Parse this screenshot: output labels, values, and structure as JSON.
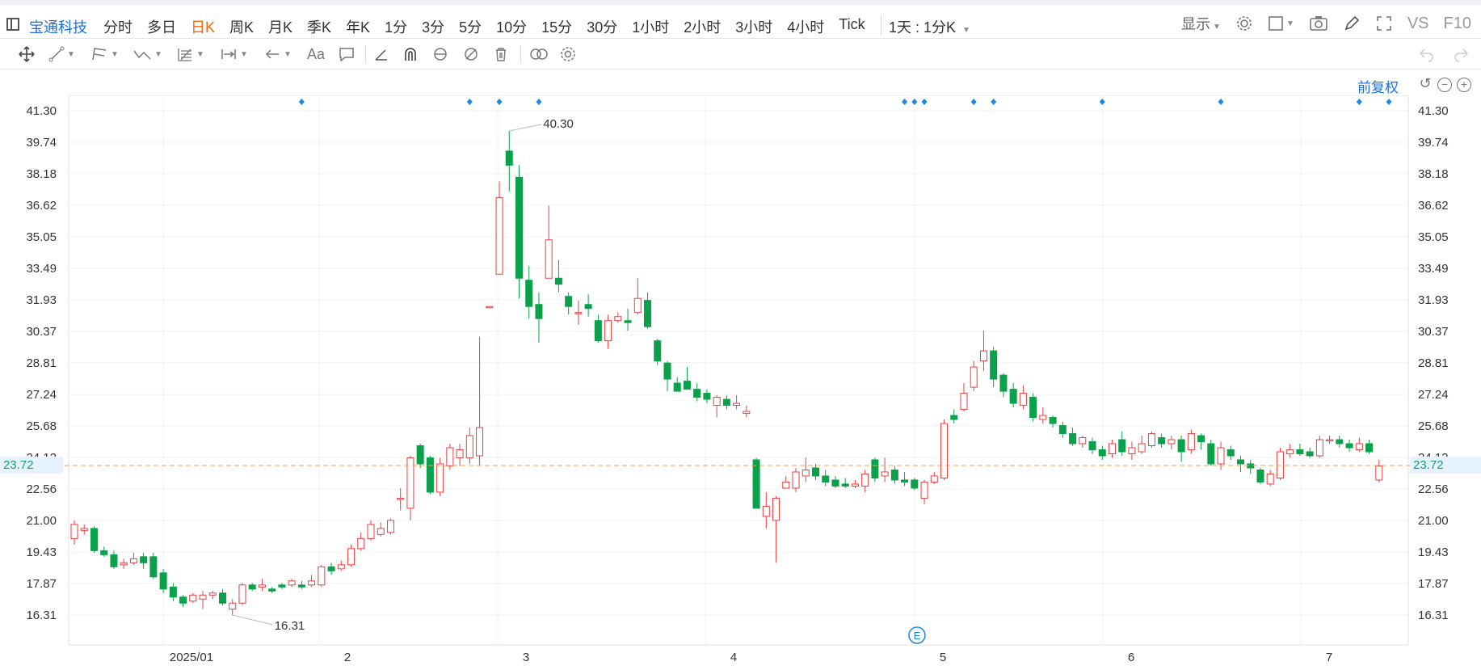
{
  "header": {
    "stock_name": "宝通科技",
    "periods": [
      "分时",
      "多日",
      "日K",
      "周K",
      "月K",
      "季K",
      "年K",
      "1分",
      "3分",
      "5分",
      "10分",
      "15分",
      "30分",
      "1小时",
      "2小时",
      "3小时",
      "4小时",
      "Tick"
    ],
    "active_period": "日K",
    "k_combo": "1天 : 1分K",
    "display_label": "显示",
    "vs_label": "VS",
    "f10_label": "F10"
  },
  "adjust": {
    "label": "前复权"
  },
  "chart_data": {
    "type": "candlestick",
    "y_ticks": [
      "41.30",
      "39.74",
      "38.18",
      "36.62",
      "35.05",
      "33.49",
      "31.93",
      "30.37",
      "28.81",
      "27.24",
      "25.68",
      "24.12",
      "22.56",
      "21.00",
      "19.43",
      "17.87",
      "16.31"
    ],
    "y_range": [
      16.31,
      41.3
    ],
    "x_labels": [
      "2025/01",
      "2",
      "3",
      "4",
      "5",
      "6",
      "7"
    ],
    "last_price": "23.72",
    "max_label": "40.30",
    "min_label": "16.31",
    "event_badge": "E",
    "up_color": "#e84141",
    "down_color": "#0aa14a",
    "grid": true,
    "candles": [
      [
        20.1,
        20.8,
        21.0,
        19.8
      ],
      [
        20.5,
        20.6,
        20.8,
        20.3
      ],
      [
        20.6,
        19.5,
        20.7,
        19.4
      ],
      [
        19.5,
        19.3,
        19.7,
        19.2
      ],
      [
        19.3,
        18.7,
        19.5,
        18.6
      ],
      [
        18.8,
        18.9,
        19.1,
        18.6
      ],
      [
        18.9,
        19.1,
        19.4,
        18.8
      ],
      [
        19.2,
        18.9,
        19.4,
        18.6
      ],
      [
        19.2,
        18.2,
        19.4,
        18.1
      ],
      [
        18.4,
        17.6,
        18.6,
        17.4
      ],
      [
        17.7,
        17.2,
        17.9,
        17.0
      ],
      [
        17.2,
        16.9,
        17.3,
        16.7
      ],
      [
        17.0,
        17.3,
        17.4,
        16.9
      ],
      [
        17.1,
        17.3,
        17.5,
        16.6
      ],
      [
        17.3,
        17.4,
        17.5,
        17.1
      ],
      [
        17.4,
        16.9,
        17.6,
        16.8
      ],
      [
        16.6,
        16.9,
        17.1,
        16.3
      ],
      [
        16.9,
        17.8,
        17.9,
        16.8
      ],
      [
        17.8,
        17.6,
        17.9,
        17.5
      ],
      [
        17.7,
        17.8,
        18.1,
        17.5
      ],
      [
        17.6,
        17.5,
        17.7,
        17.4
      ],
      [
        17.8,
        17.7,
        17.9,
        17.6
      ],
      [
        17.8,
        18.0,
        18.1,
        17.7
      ],
      [
        17.8,
        17.7,
        18.0,
        17.6
      ],
      [
        17.8,
        18.0,
        18.3,
        17.7
      ],
      [
        17.8,
        18.7,
        18.8,
        17.7
      ],
      [
        18.7,
        18.5,
        18.9,
        18.3
      ],
      [
        18.6,
        18.8,
        19.0,
        18.5
      ],
      [
        18.8,
        19.6,
        19.8,
        18.7
      ],
      [
        19.6,
        20.1,
        20.4,
        19.5
      ],
      [
        20.1,
        20.8,
        21.0,
        20.0
      ],
      [
        20.3,
        20.6,
        20.9,
        20.2
      ],
      [
        20.4,
        21.0,
        21.1,
        20.3
      ],
      [
        22.1,
        22.1,
        22.6,
        21.5
      ],
      [
        21.6,
        24.1,
        24.2,
        21.0
      ],
      [
        24.7,
        23.8,
        24.8,
        23.6
      ],
      [
        24.1,
        22.4,
        24.2,
        22.3
      ],
      [
        22.4,
        23.8,
        24.1,
        22.2
      ],
      [
        23.7,
        24.6,
        24.8,
        23.5
      ],
      [
        24.1,
        24.5,
        24.8,
        23.7
      ],
      [
        24.1,
        25.2,
        25.6,
        23.8
      ],
      [
        24.2,
        25.6,
        30.1,
        23.7
      ],
      [
        31.6,
        31.6,
        31.6,
        31.6
      ],
      [
        33.2,
        37.0,
        37.8,
        33.2
      ],
      [
        39.3,
        38.6,
        40.3,
        37.3
      ],
      [
        38.0,
        33.0,
        38.6,
        32.0
      ],
      [
        32.9,
        31.6,
        33.6,
        31.0
      ],
      [
        31.7,
        31.0,
        32.3,
        29.8
      ],
      [
        33.0,
        34.9,
        36.6,
        33.0
      ],
      [
        33.0,
        32.7,
        33.9,
        32.3
      ],
      [
        32.1,
        31.6,
        32.3,
        31.2
      ],
      [
        31.3,
        31.3,
        31.9,
        30.7
      ],
      [
        31.7,
        31.5,
        32.2,
        31.1
      ],
      [
        30.9,
        29.9,
        31.2,
        29.8
      ],
      [
        29.9,
        30.9,
        31.2,
        29.5
      ],
      [
        30.9,
        31.1,
        31.3,
        30.8
      ],
      [
        30.9,
        30.8,
        31.5,
        30.4
      ],
      [
        31.3,
        32.0,
        33.0,
        31.2
      ],
      [
        31.9,
        30.6,
        32.3,
        30.5
      ],
      [
        29.9,
        28.9,
        30.0,
        28.7
      ],
      [
        28.8,
        28.0,
        28.9,
        27.4
      ],
      [
        27.8,
        27.4,
        28.1,
        27.4
      ],
      [
        27.9,
        27.5,
        28.6,
        27.5
      ],
      [
        27.5,
        27.1,
        27.8,
        26.9
      ],
      [
        27.3,
        27.0,
        27.5,
        26.8
      ],
      [
        26.7,
        27.1,
        27.2,
        26.1
      ],
      [
        27.0,
        26.7,
        27.2,
        26.5
      ],
      [
        26.7,
        26.8,
        27.2,
        26.5
      ],
      [
        26.3,
        26.4,
        26.7,
        26.1
      ],
      [
        24.0,
        21.6,
        24.1,
        21.6
      ],
      [
        21.2,
        21.7,
        22.4,
        20.6
      ],
      [
        21.0,
        22.1,
        22.2,
        18.9
      ],
      [
        22.6,
        22.9,
        23.2,
        22.6
      ],
      [
        22.6,
        23.4,
        23.6,
        22.4
      ],
      [
        23.2,
        23.5,
        24.1,
        22.9
      ],
      [
        23.6,
        23.2,
        23.8,
        23.0
      ],
      [
        23.2,
        22.9,
        23.5,
        22.7
      ],
      [
        23.0,
        22.7,
        23.2,
        22.6
      ],
      [
        22.8,
        22.7,
        23.1,
        22.6
      ],
      [
        22.7,
        22.8,
        23.0,
        22.6
      ],
      [
        22.7,
        23.3,
        23.5,
        22.4
      ],
      [
        24.0,
        23.1,
        24.1,
        22.9
      ],
      [
        23.2,
        23.4,
        24.1,
        22.9
      ],
      [
        23.5,
        23.0,
        23.7,
        22.8
      ],
      [
        23.0,
        22.9,
        23.4,
        22.7
      ],
      [
        23.0,
        22.6,
        23.1,
        22.5
      ],
      [
        22.1,
        22.9,
        23.0,
        21.8
      ],
      [
        22.9,
        23.2,
        23.4,
        22.8
      ],
      [
        23.1,
        25.8,
        26.0,
        23.0
      ],
      [
        26.2,
        26.0,
        26.5,
        25.8
      ],
      [
        26.5,
        27.3,
        27.8,
        26.4
      ],
      [
        27.6,
        28.6,
        28.9,
        27.4
      ],
      [
        28.9,
        29.4,
        30.4,
        28.4
      ],
      [
        29.4,
        28.0,
        29.6,
        27.6
      ],
      [
        28.2,
        27.4,
        28.3,
        27.1
      ],
      [
        27.5,
        26.8,
        27.8,
        26.6
      ],
      [
        26.7,
        27.3,
        27.7,
        26.5
      ],
      [
        27.1,
        26.1,
        27.3,
        25.9
      ],
      [
        26.0,
        26.2,
        26.6,
        25.8
      ],
      [
        26.1,
        25.8,
        26.2,
        25.6
      ],
      [
        25.7,
        25.3,
        25.9,
        25.1
      ],
      [
        25.3,
        24.8,
        25.6,
        24.7
      ],
      [
        24.8,
        25.1,
        25.2,
        24.6
      ],
      [
        24.9,
        24.5,
        25.1,
        24.3
      ],
      [
        24.5,
        24.2,
        24.7,
        24.0
      ],
      [
        24.3,
        24.8,
        25.0,
        24.1
      ],
      [
        25.0,
        24.4,
        25.4,
        24.2
      ],
      [
        24.3,
        24.6,
        24.9,
        24.0
      ],
      [
        24.4,
        24.8,
        25.2,
        24.3
      ],
      [
        24.7,
        25.3,
        25.4,
        24.6
      ],
      [
        25.1,
        24.8,
        25.3,
        24.6
      ],
      [
        24.8,
        25.0,
        25.2,
        24.5
      ],
      [
        25.0,
        24.4,
        25.2,
        23.9
      ],
      [
        24.5,
        25.3,
        25.5,
        24.3
      ],
      [
        25.2,
        24.9,
        25.3,
        24.5
      ],
      [
        24.8,
        23.8,
        25.0,
        23.7
      ],
      [
        23.8,
        24.6,
        24.9,
        23.5
      ],
      [
        24.5,
        24.2,
        24.7,
        24.0
      ],
      [
        24.0,
        23.8,
        24.2,
        23.4
      ],
      [
        23.8,
        23.6,
        24.0,
        23.3
      ],
      [
        23.5,
        22.9,
        23.6,
        22.8
      ],
      [
        22.8,
        23.3,
        23.5,
        22.7
      ],
      [
        23.1,
        24.4,
        24.6,
        23.0
      ],
      [
        24.3,
        24.5,
        24.8,
        24.1
      ],
      [
        24.5,
        24.3,
        24.8,
        24.2
      ],
      [
        24.4,
        24.2,
        24.6,
        24.1
      ],
      [
        24.2,
        25.0,
        25.2,
        24.1
      ],
      [
        25.0,
        25.0,
        25.2,
        24.8
      ],
      [
        25.0,
        24.8,
        25.2,
        24.6
      ],
      [
        24.8,
        24.6,
        25.0,
        24.4
      ],
      [
        24.5,
        24.8,
        25.1,
        24.4
      ],
      [
        24.8,
        24.4,
        25.0,
        24.3
      ],
      [
        23.0,
        23.7,
        24.0,
        22.9
      ]
    ],
    "markers_idx": [
      23,
      40,
      43,
      47,
      84,
      85,
      86,
      91,
      93,
      104,
      116,
      130,
      133
    ]
  }
}
